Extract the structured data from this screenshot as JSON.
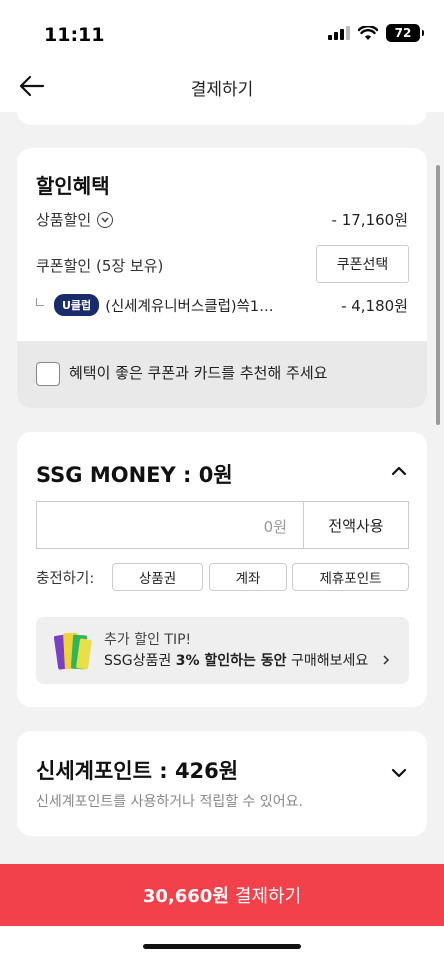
{
  "status_bar": {
    "time": "11:11",
    "battery": "72"
  },
  "nav": {
    "title": "결제하기"
  },
  "discount": {
    "title": "할인혜택",
    "product_discount_label": "상품할인",
    "product_discount_value": "- 17,160원",
    "coupon_discount_label": "쿠폰할인 (5장 보유)",
    "coupon_select_button": "쿠폰선택",
    "coupon_badge": "U클럽",
    "coupon_name": "(신세계유니버스클럽)쓱1…",
    "coupon_value": "- 4,180원",
    "recommend_text": "혜택이 좋은 쿠폰과 카드를 추천해 주세요"
  },
  "ssg_money": {
    "title": "SSG MONEY : 0원",
    "input_value": "0원",
    "use_all_button": "전액사용",
    "charge_label": "충전하기:",
    "charge_options": [
      "상품권",
      "계좌",
      "제휴포인트"
    ],
    "tip_title": "추가 할인 TIP!",
    "tip_prefix": "SSG상품권 ",
    "tip_bold": "3% 할인하는 동안",
    "tip_suffix": " 구매해보세요"
  },
  "shinsegae_point": {
    "title": "신세계포인트 : 426원",
    "subtitle": "신세계포인트를 사용하거나 적립할 수 있어요."
  },
  "pay_button": {
    "amount": "30,660원",
    "label": "결제하기"
  },
  "colors": {
    "accent": "#f2414a",
    "uclub_badge": "#1a2b6b"
  }
}
